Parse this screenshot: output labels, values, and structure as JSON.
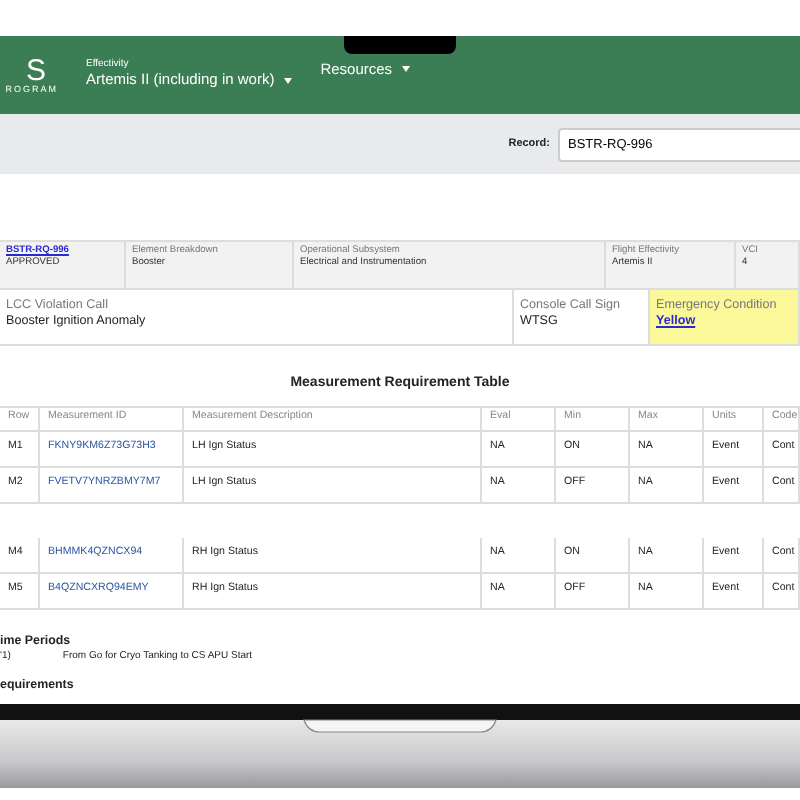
{
  "header": {
    "logo": "S",
    "logo_sub": "ROGRAM",
    "effectivity_label": "Effectivity",
    "effectivity_value": "Artemis II (including in work)",
    "menus": [
      "Resources"
    ]
  },
  "record_bar": {
    "label": "Record:",
    "value": "BSTR-RQ-996"
  },
  "summary_rows": [
    [
      {
        "label": "BSTR-RQ-996",
        "value": "APPROVED",
        "kind": "link"
      },
      {
        "label": "Element Breakdown",
        "value": "Booster",
        "kind": "plain"
      },
      {
        "label": "Operational Subsystem",
        "value": "Electrical and Instrumentation",
        "kind": "plain"
      },
      {
        "label": "Flight Effectivity",
        "value": "Artemis II",
        "kind": "plain"
      },
      {
        "label": "VCI",
        "value": "4",
        "kind": "plain"
      }
    ],
    [
      {
        "label": "LCC Violation Call",
        "value": "Booster Ignition Anomaly",
        "kind": "plain"
      },
      {
        "label": "Console Call Sign",
        "value": "WTSG",
        "kind": "plain"
      },
      {
        "label": "Emergency Condition",
        "value": "Yellow",
        "kind": "value-link",
        "color": "#fbf89a"
      }
    ]
  ],
  "table": {
    "title": "Measurement Requirement Table",
    "columns": [
      "Row",
      "Measurement ID",
      "Measurement Description",
      "Eval",
      "Min",
      "Max",
      "Units",
      "Code"
    ],
    "rows": [
      {
        "cells": [
          "M1",
          "FKNY9KM6Z73G73H3",
          "LH Ign Status",
          "NA",
          "ON",
          "NA",
          "Event",
          "Cont"
        ]
      },
      {
        "cells": [
          "M2",
          "FVETV7YNRZBMY7M7",
          "LH Ign Status",
          "NA",
          "OFF",
          "NA",
          "Event",
          "Cont"
        ]
      },
      {
        "cells": [
          "M4",
          "BHMMK4QZNCX94",
          "RH Ign Status",
          "NA",
          "ON",
          "NA",
          "Event",
          "Cont"
        ]
      },
      {
        "cells": [
          "M5",
          "B4QZNCXRQ94EMY",
          "RH Ign Status",
          "NA",
          "OFF",
          "NA",
          "Event",
          "Cont"
        ]
      }
    ]
  },
  "time_periods": {
    "heading": "ime Periods",
    "items": [
      {
        "code": "'1)",
        "text": "From Go for Cryo Tanking to CS APU Start"
      }
    ]
  },
  "requirements": {
    "heading": "equirements"
  }
}
